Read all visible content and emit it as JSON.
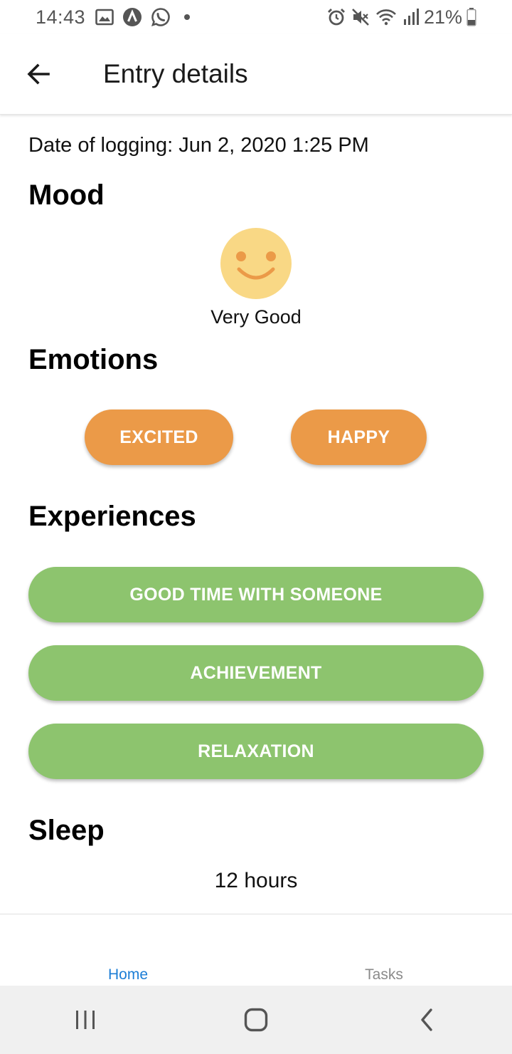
{
  "status_bar": {
    "time": "14:43",
    "battery": "21%",
    "left_icons": [
      "gallery-icon",
      "vpn-a-icon",
      "whatsapp-icon",
      "dot-icon"
    ],
    "right_icons": [
      "alarm-icon",
      "mute-vibrate-icon",
      "wifi-icon",
      "signal-icon",
      "battery-icon"
    ]
  },
  "header": {
    "title": "Entry details",
    "back_icon": "arrow-left-icon"
  },
  "entry": {
    "date_line": "Date of logging: Jun 2, 2020 1:25 PM",
    "mood": {
      "title": "Mood",
      "label": "Very Good",
      "icon": "smiley-face-icon",
      "face_color": "#f9d885",
      "feature_color": "#eb9a48"
    },
    "emotions": {
      "title": "Emotions",
      "items": [
        "EXCITED",
        "HAPPY"
      ],
      "chip_color": "#eb9a48"
    },
    "experiences": {
      "title": "Experiences",
      "items": [
        "GOOD TIME WITH SOMEONE",
        "ACHIEVEMENT",
        "RELAXATION"
      ],
      "chip_color": "#8dc46e"
    },
    "sleep": {
      "title": "Sleep",
      "value": "12 hours"
    }
  },
  "tabs": [
    {
      "label": "Home",
      "active": true
    },
    {
      "label": "Tasks",
      "active": false
    }
  ],
  "colors": {
    "active_tab": "#1c7ed6",
    "inactive_tab": "#8a8a8a"
  },
  "nav_bar": {
    "buttons": [
      "recents-icon",
      "home-circle-icon",
      "back-chevron-icon"
    ]
  }
}
